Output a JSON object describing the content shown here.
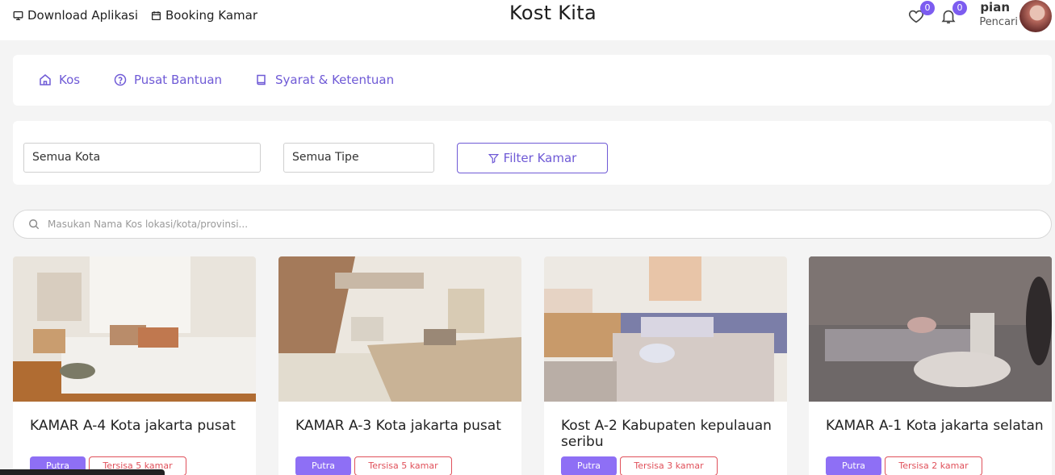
{
  "header": {
    "download_label": "Download Aplikasi",
    "booking_label": "Booking Kamar",
    "brand": "Kost Kita",
    "favorites_count": "0",
    "notifications_count": "0",
    "user_name": "pian",
    "user_role": "Pencari"
  },
  "nav": {
    "items": [
      {
        "label": "Kos",
        "icon": "home-icon"
      },
      {
        "label": "Pusat Bantuan",
        "icon": "help-circle-icon"
      },
      {
        "label": "Syarat & Ketentuan",
        "icon": "book-icon"
      }
    ]
  },
  "filter": {
    "city_value": "Semua Kota",
    "type_value": "Semua Tipe",
    "button_label": "Filter Kamar"
  },
  "search": {
    "placeholder": "Masukan Nama Kos lokasi/kota/provinsi..."
  },
  "listings": [
    {
      "title": "KAMAR A-4 Kota jakarta pusat",
      "type": "Putra",
      "remaining": "Tersisa 5 kamar"
    },
    {
      "title": "KAMAR A-3 Kota jakarta pusat",
      "type": "Putra",
      "remaining": "Tersisa 5 kamar"
    },
    {
      "title": "Kost A-2 Kabupaten kepulauan seribu",
      "type": "Putra",
      "remaining": "Tersisa 3 kamar"
    },
    {
      "title": "KAMAR A-1 Kota jakarta selatan",
      "type": "Putra",
      "remaining": "Tersisa 2 kamar"
    }
  ],
  "colors": {
    "accent": "#6f5ad6",
    "badge": "#7c5cf0",
    "tag_type": "#8e6ff5",
    "tag_remaining": "#e0505a"
  }
}
